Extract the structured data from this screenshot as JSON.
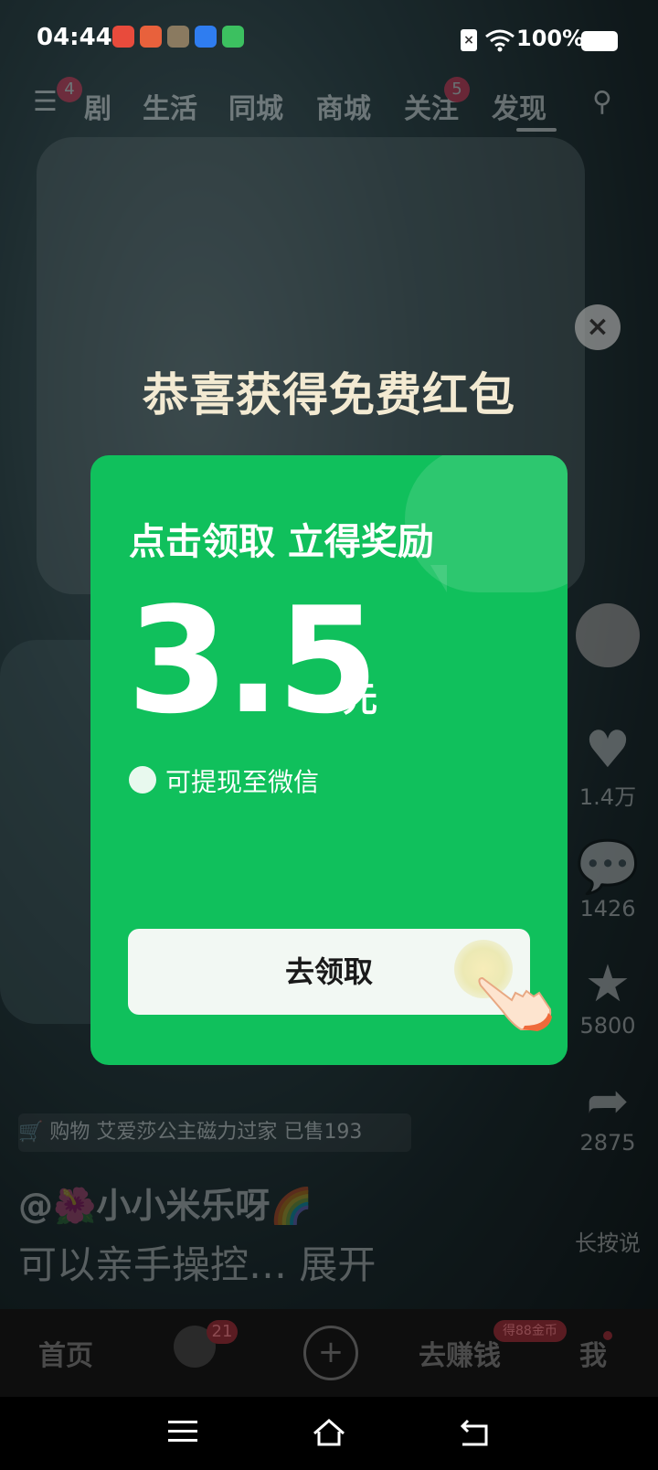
{
  "status_bar": {
    "time": "04:44",
    "battery": "100%",
    "sim": "×"
  },
  "top_nav": {
    "tabs": [
      "剧",
      "生活",
      "同城",
      "商城",
      "关注",
      "发现"
    ],
    "badges": {
      "menu": "4",
      "follow": "5"
    }
  },
  "side_actions": {
    "likes": "1.4万",
    "comments": "1426",
    "favorites": "5800",
    "shares": "2875",
    "voice": "长按说"
  },
  "video_info": {
    "shop_label": "购物",
    "shop_item": "艾爱莎公主磁力过家",
    "sold": "已售193",
    "author": "@🌺小小米乐呀🌈",
    "caption": "可以亲手操控… 展开"
  },
  "modal": {
    "title": "恭喜获得免费红包",
    "subtitle": "点击领取 立得奖励",
    "amount": "3.5",
    "unit": "元",
    "wechat_text": "可提现至微信",
    "cta": "去领取",
    "close": "×"
  },
  "bottom_nav": {
    "home": "首页",
    "friends_badge": "21",
    "plus": "+",
    "earn": "去赚钱",
    "earn_badge": "得88金币",
    "me": "我"
  },
  "colors": {
    "card_green": "#10c05c",
    "title_cream": "#f3ead2"
  }
}
